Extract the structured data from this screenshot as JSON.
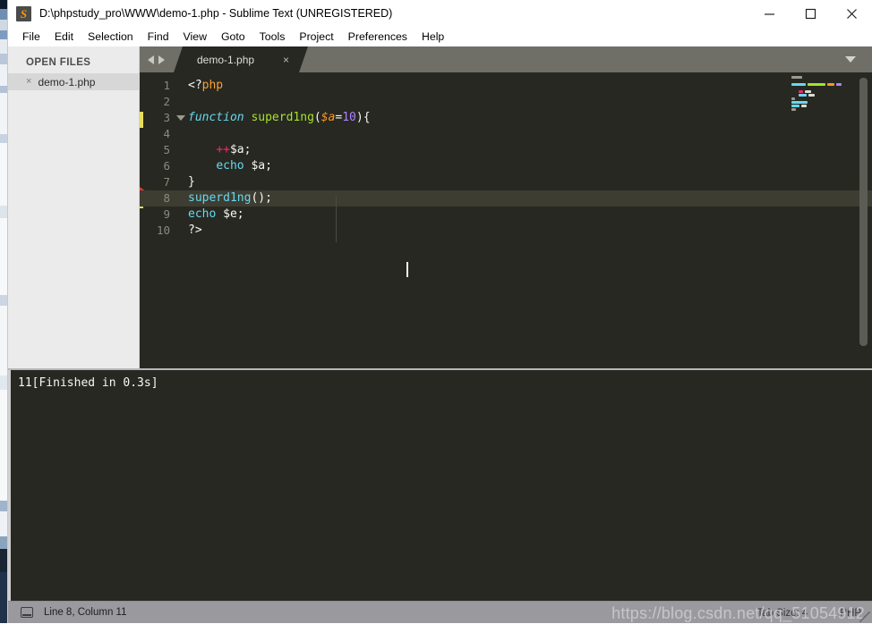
{
  "window": {
    "title": "D:\\phpstudy_pro\\WWW\\demo-1.php - Sublime Text (UNREGISTERED)",
    "app_icon": "sublime-text-icon",
    "controls": {
      "minimize": "minimize-icon",
      "maximize": "maximize-icon",
      "close": "close-icon"
    }
  },
  "menubar": {
    "items": [
      {
        "label": "File"
      },
      {
        "label": "Edit"
      },
      {
        "label": "Selection"
      },
      {
        "label": "Find"
      },
      {
        "label": "View"
      },
      {
        "label": "Goto"
      },
      {
        "label": "Tools"
      },
      {
        "label": "Project"
      },
      {
        "label": "Preferences"
      },
      {
        "label": "Help"
      }
    ]
  },
  "sidebar": {
    "header": "OPEN FILES",
    "files": [
      {
        "name": "demo-1.php",
        "close_glyph": "×",
        "selected": true
      }
    ]
  },
  "tabbar": {
    "nav_prev": "arrow-left-icon",
    "nav_next": "arrow-right-icon",
    "menu_glyph": "chevron-down-icon",
    "tabs": [
      {
        "label": "demo-1.php",
        "close_glyph": "×",
        "active": true
      }
    ]
  },
  "editor": {
    "language": "PHP",
    "lines": [
      {
        "no": "1",
        "text": "<?php"
      },
      {
        "no": "2",
        "text": ""
      },
      {
        "no": "3",
        "text": "function superd1ng($a=10){"
      },
      {
        "no": "4",
        "text": ""
      },
      {
        "no": "5",
        "text": "    ++$a;"
      },
      {
        "no": "6",
        "text": "    echo $a;"
      },
      {
        "no": "7",
        "text": "}"
      },
      {
        "no": "8",
        "text": "superd1ng();"
      },
      {
        "no": "9",
        "text": "echo $e;"
      },
      {
        "no": "10",
        "text": "?>"
      }
    ],
    "tokens": {
      "l1_open": "<?",
      "l1_php": "php",
      "l3_kw": "function",
      "l3_name": "superd1ng",
      "l3_paren_open": "(",
      "l3_var": "$a",
      "l3_eq": "=",
      "l3_num": "10",
      "l3_paren_close": ")",
      "l3_brace": "{",
      "l5_indent": "    ",
      "l5_inc": "++",
      "l5_var": "$a;",
      "l6_indent": "    ",
      "l6_echo": "echo",
      "l6_var": " $a;",
      "l7_brace": "}",
      "l8_call": "superd1ng",
      "l8_rest": "();",
      "l9_echo": "echo",
      "l9_var": " $e;",
      "l10_close": "?>"
    },
    "markers": {
      "line3": "modified-marker",
      "line8": "error-marker"
    },
    "current_line": "8"
  },
  "console": {
    "output": "11[Finished in 0.3s]"
  },
  "statusbar": {
    "icon": "panel-toggle-icon",
    "position": "Line 8, Column 11",
    "tab_size": "Tab Size: 4",
    "syntax": "PHP",
    "watermark": "https://blog.csdn.net/qq_51054912"
  },
  "colors": {
    "editor_bg": "#272822",
    "current_line": "#3e3d32",
    "keyword": "#66d9ef",
    "function": "#a6e22e",
    "variable": "#fd971f",
    "number": "#ae81ff",
    "operator": "#f92672",
    "marker_yellow": "#e6dd5e",
    "marker_red": "#e6352b"
  }
}
